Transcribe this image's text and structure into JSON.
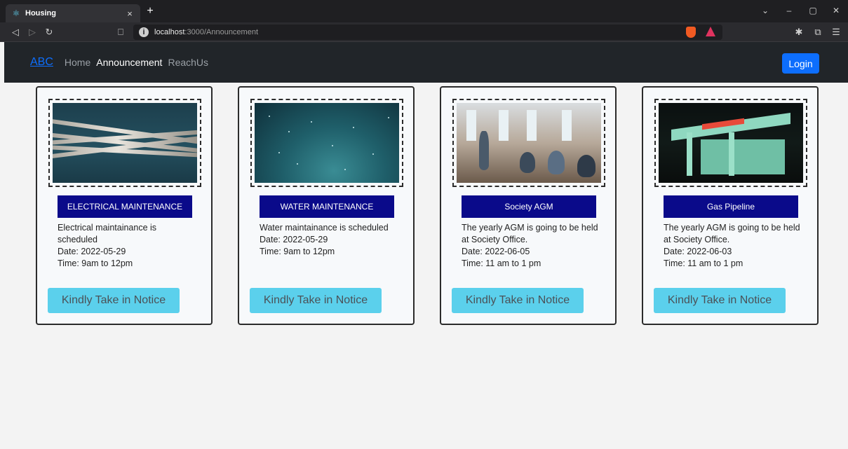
{
  "browser": {
    "tab_title": "Housing",
    "tab_close": "×",
    "new_tab": "+",
    "url_host": "localhost",
    "url_path": ":3000/Announcement",
    "url_info": "i",
    "controls": {
      "minimize": "–",
      "restore": "▢",
      "close": "✕",
      "dropdown": "⌄"
    },
    "nav": {
      "back": "◁",
      "forward": "▷",
      "reload": "↻",
      "bookmark": "⎕"
    },
    "extensions": {
      "puzzle": "✱",
      "wallet": "⧉",
      "menu": "☰"
    }
  },
  "navbar": {
    "brand": "ABC",
    "links": [
      {
        "label": "Home",
        "active": false
      },
      {
        "label": "Announcement",
        "active": true
      },
      {
        "label": "ReachUs",
        "active": false
      }
    ],
    "login_label": "Login"
  },
  "cards": [
    {
      "title": "ELECTRICAL MAINTENANCE",
      "desc": "Electrical maintainance is scheduled",
      "date": "Date: 2022-05-29",
      "time": "Time: 9am to 12pm",
      "button": "Kindly Take in Notice",
      "image": "electrical-cables-photo"
    },
    {
      "title": "WATER MAINTENANCE",
      "desc": "Water maintainance is scheduled",
      "date": "Date: 2022-05-29",
      "time": "Time: 9am to 12pm",
      "button": "Kindly Take in Notice",
      "image": "underwater-photo"
    },
    {
      "title": "Society AGM",
      "desc": "The yearly AGM is going to be held at Society Office.",
      "date": "Date: 2022-06-05",
      "time": "Time: 11 am to 1 pm",
      "button": "Kindly Take in Notice",
      "image": "office-meeting-photo"
    },
    {
      "title": "Gas Pipeline",
      "desc": "The yearly AGM is going to be held at Society Office.",
      "date": "Date: 2022-06-03",
      "time": "Time: 11 am to 1 pm",
      "button": "Kindly Take in Notice",
      "image": "gas-station-photo"
    }
  ],
  "colors": {
    "navbar_bg": "#212529",
    "brand": "#0d6efd",
    "login_bg": "#0d6efd",
    "card_title_bg": "#0a0a8a",
    "notice_btn_bg": "#5bd0ec"
  }
}
